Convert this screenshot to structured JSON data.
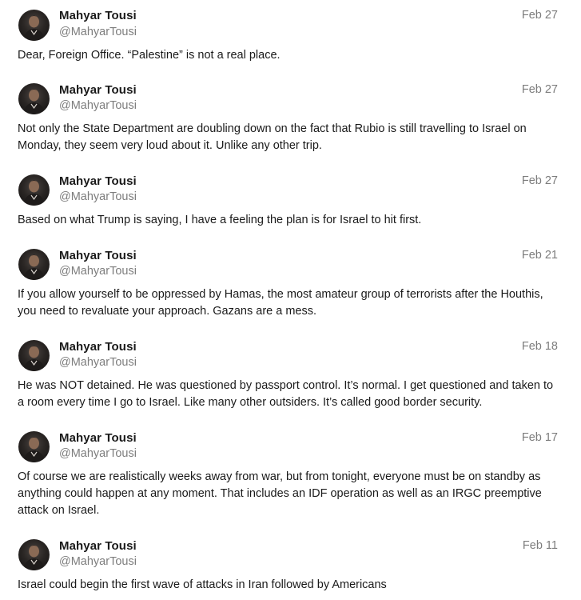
{
  "feed": {
    "posts": [
      {
        "author_name": "Mahyar Tousi",
        "author_handle": "@MahyarTousi",
        "date": "Feb 27",
        "text": "Dear, Foreign Office. “Palestine” is not a real place."
      },
      {
        "author_name": "Mahyar Tousi",
        "author_handle": "@MahyarTousi",
        "date": "Feb 27",
        "text": "Not only the State Department are doubling down on the fact that Rubio is still travelling to Israel on Monday, they seem very loud about it. Unlike any other trip."
      },
      {
        "author_name": "Mahyar Tousi",
        "author_handle": "@MahyarTousi",
        "date": "Feb 27",
        "text": "Based on what Trump is saying, I have a feeling the plan is for Israel to hit first."
      },
      {
        "author_name": "Mahyar Tousi",
        "author_handle": "@MahyarTousi",
        "date": "Feb 21",
        "text": "If you allow yourself to be oppressed by Hamas, the most amateur group of terrorists after the Houthis, you need to revaluate your approach. Gazans are a mess."
      },
      {
        "author_name": "Mahyar Tousi",
        "author_handle": "@MahyarTousi",
        "date": "Feb 18",
        "text": "He was NOT detained. He was questioned by passport control. It’s normal. I get questioned and taken to a room every time I go to Israel. Like many other outsiders. It’s called good border security."
      },
      {
        "author_name": "Mahyar Tousi",
        "author_handle": "@MahyarTousi",
        "date": "Feb 17",
        "text": "Of course we are realistically weeks away from war, but from tonight, everyone must be on standby as anything could happen at any moment. That includes an IDF operation as well as an IRGC preemptive attack on Israel."
      },
      {
        "author_name": "Mahyar Tousi",
        "author_handle": "@MahyarTousi",
        "date": "Feb 11",
        "text": "Israel could begin the first wave of attacks in Iran followed by Americans"
      }
    ]
  }
}
